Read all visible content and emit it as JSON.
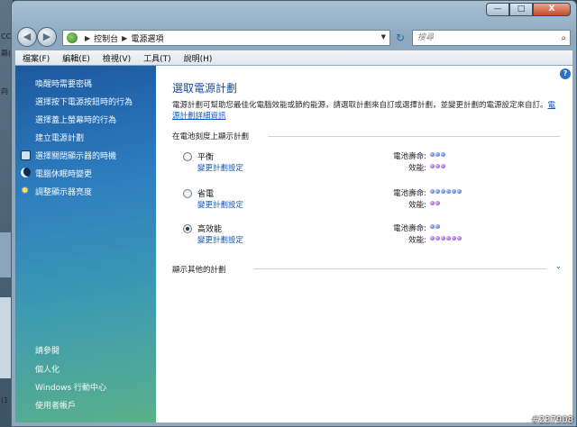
{
  "window": {
    "caption_min": "—",
    "caption_max": "□",
    "caption_close": "X"
  },
  "address": {
    "crumbs": [
      "控制台",
      "電源選項"
    ],
    "search_placeholder": "搜尋"
  },
  "menu": [
    "檔案(F)",
    "編輯(E)",
    "檢視(V)",
    "工具(T)",
    "說明(H)"
  ],
  "sidebar": {
    "links": [
      "喚醒時需要密碼",
      "選擇按下電源按鈕時的行為",
      "選擇蓋上螢幕時的行為",
      "建立電源計劃"
    ],
    "icon_links": [
      {
        "label": "選擇關閉顯示器的時機",
        "icon": "monitor-icon"
      },
      {
        "label": "電腦休眠時變更",
        "icon": "moon-icon"
      },
      {
        "label": "調整顯示器亮度",
        "icon": "sun-icon"
      }
    ],
    "see_also": "請參閱",
    "bottom_links": [
      "個人化",
      "Windows 行動中心",
      "使用者帳戶"
    ]
  },
  "main": {
    "title": "選取電源計劃",
    "intro_text": "電源計劃可幫助您最佳化電腦效能或節約能源，請選取計劃來自訂或選擇計劃，並變更計劃的電源設定來自訂。",
    "intro_link": "電源計劃詳細資訊",
    "section_header": "在電池刻度上顯示計劃",
    "battery_label": "電池壽命:",
    "performance_label": "效能:",
    "change_link": "變更計劃設定",
    "plans": [
      {
        "name": "平衡",
        "battery": 3,
        "performance": 3,
        "checked": false
      },
      {
        "name": "省電",
        "battery": 6,
        "performance": 2,
        "checked": false
      },
      {
        "name": "高效能",
        "battery": 2,
        "performance": 6,
        "checked": true
      }
    ],
    "more_plans": "顯示其他的計劃"
  },
  "background": {
    "left_text": [
      "CC",
      "幕(",
      "向",
      "(1"
    ]
  },
  "watermark": "#237908",
  "colors": {
    "link": "#1256c2",
    "title": "#1a4fa3",
    "dot_blue": "#2b5bd6",
    "dot_purple": "#8a2bc7"
  }
}
